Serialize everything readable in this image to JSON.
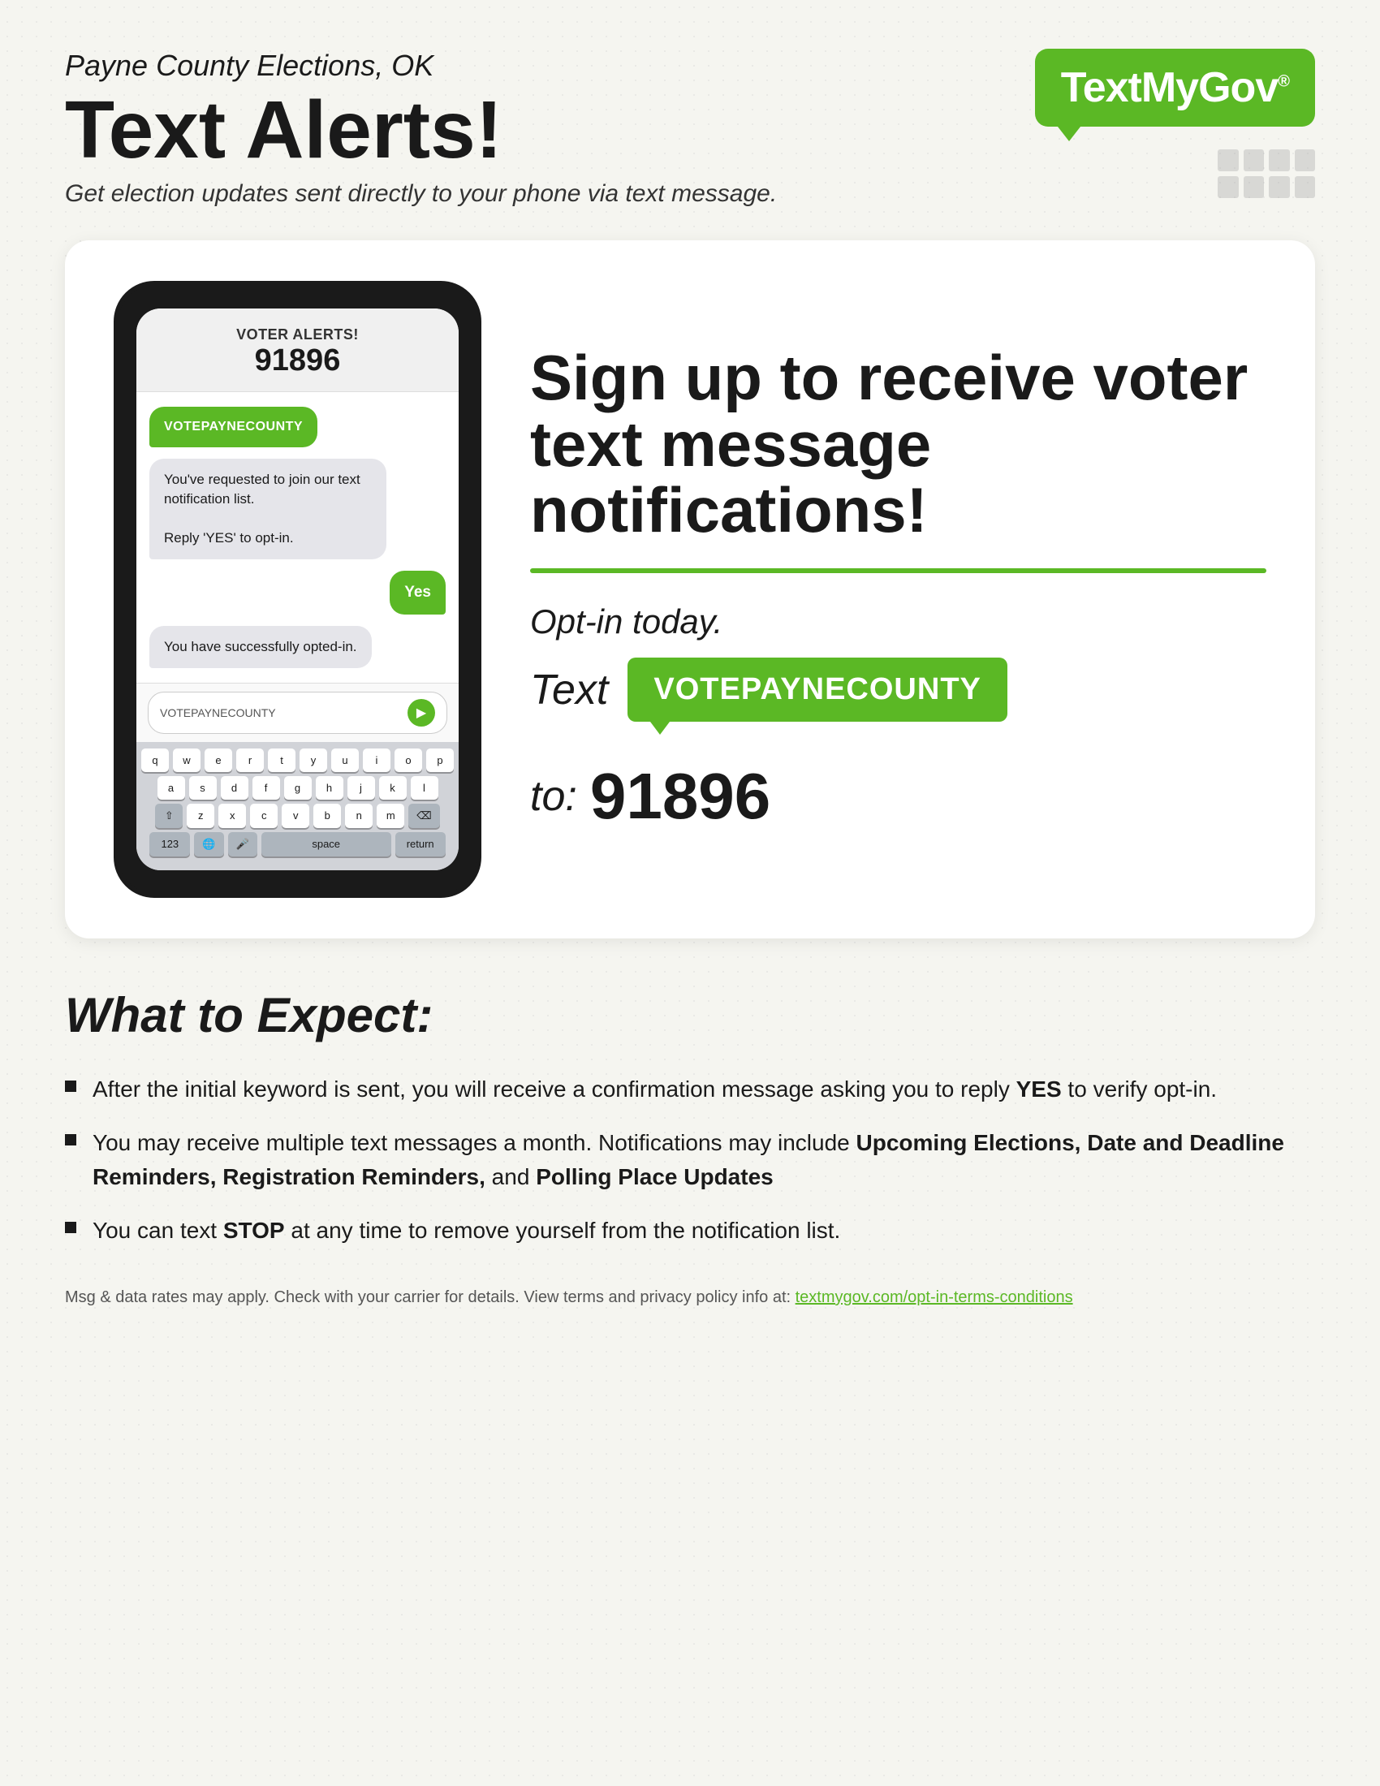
{
  "header": {
    "subtitle": "Payne County Elections, OK",
    "main_title": "Text Alerts!",
    "tagline": "Get election updates sent directly to your phone via text message.",
    "logo_text": "TextMyGov",
    "logo_registered": "®"
  },
  "phone": {
    "alert_label": "VOTER ALERTS!",
    "number": "91896",
    "messages": [
      {
        "type": "sent",
        "text": "VOTEPAYNECOUNTY"
      },
      {
        "type": "received",
        "text": "You've requested to join our text notification list.\n\nReply 'YES' to opt-in."
      },
      {
        "type": "reply",
        "text": "Yes"
      },
      {
        "type": "received",
        "text": "You have successfully opted-in."
      }
    ],
    "input_text": "VOTEPAYNECOUNTY",
    "keyboard": {
      "row1": [
        "q",
        "w",
        "e",
        "r",
        "t",
        "y",
        "u",
        "i",
        "o",
        "p"
      ],
      "row2": [
        "a",
        "s",
        "d",
        "f",
        "g",
        "h",
        "j",
        "k",
        "l"
      ],
      "row3": [
        "⇧",
        "z",
        "x",
        "c",
        "v",
        "b",
        "n",
        "m",
        "⌫"
      ],
      "row4": [
        "123",
        "🌐",
        "🎤",
        "space",
        "return"
      ]
    }
  },
  "signup": {
    "headline": "Sign up to receive voter text message notifications!",
    "divider": true,
    "opt_in_label": "Opt-in today.",
    "text_word": "Text",
    "keyword": "VOTEPAYNECOUNTY",
    "to_label": "to:",
    "to_number": "91896"
  },
  "expect": {
    "title": "What to Expect:",
    "bullets": [
      "After the initial keyword is sent, you will receive a confirmation message asking you to reply YES to verify opt-in.",
      "You may receive multiple text messages a month. Notifications may include Upcoming Elections, Date and Deadline Reminders, Registration Reminders, and Polling Place Updates",
      "You can text STOP at any time to remove yourself from the notification list."
    ],
    "bold_segments": {
      "bullet_0": [
        "YES"
      ],
      "bullet_1": [
        "Upcoming Elections, Date and Deadline Reminders, Registration Reminders,",
        "Polling Place Updates"
      ],
      "bullet_2": [
        "STOP"
      ]
    }
  },
  "footer": {
    "disclaimer": "Msg & data rates may apply. Check with your carrier for details. View terms and privacy policy info at:",
    "link_text": "textmygov.com/opt-in-terms-conditions",
    "link_url": "textmygov.com/opt-in-terms-conditions"
  },
  "colors": {
    "green": "#5bb825",
    "dark": "#1a1a1a",
    "light_gray": "#e5e5ea",
    "white": "#ffffff"
  }
}
